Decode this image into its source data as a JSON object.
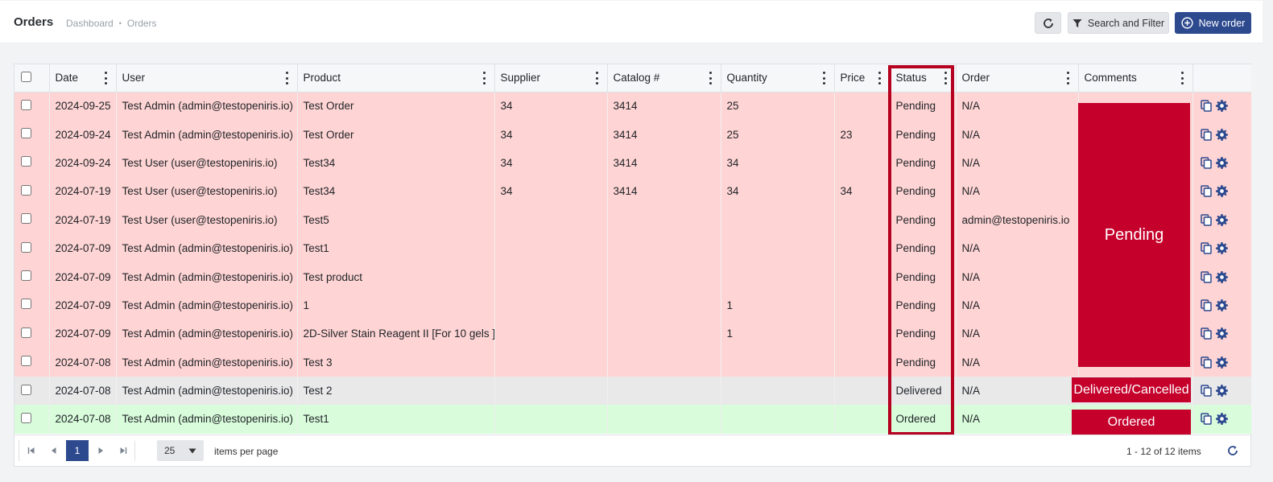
{
  "header": {
    "title": "Orders",
    "breadcrumb": [
      "Dashboard",
      "Orders"
    ],
    "breadcrumb_sep": "•",
    "filter_label": "Search and Filter",
    "new_label": "New order"
  },
  "columns": [
    "",
    "Date",
    "User",
    "Product",
    "Supplier",
    "Catalog #",
    "Quantity",
    "Price",
    "Status",
    "Order",
    "Comments",
    ""
  ],
  "rows": [
    {
      "date": "2024-09-25",
      "user": "Test Admin (admin@testopeniris.io)",
      "product": "Test Order",
      "supplier": "34",
      "catalog": "3414",
      "quantity": "25",
      "price": "",
      "status": "Pending",
      "order": "N/A"
    },
    {
      "date": "2024-09-24",
      "user": "Test Admin (admin@testopeniris.io)",
      "product": "Test Order",
      "supplier": "34",
      "catalog": "3414",
      "quantity": "25",
      "price": "23",
      "status": "Pending",
      "order": "N/A"
    },
    {
      "date": "2024-09-24",
      "user": "Test User (user@testopeniris.io)",
      "product": "Test34",
      "supplier": "34",
      "catalog": "3414",
      "quantity": "34",
      "price": "",
      "status": "Pending",
      "order": "N/A"
    },
    {
      "date": "2024-07-19",
      "user": "Test User (user@testopeniris.io)",
      "product": "Test34",
      "supplier": "34",
      "catalog": "3414",
      "quantity": "34",
      "price": "34",
      "status": "Pending",
      "order": "N/A"
    },
    {
      "date": "2024-07-19",
      "user": "Test User (user@testopeniris.io)",
      "product": "Test5",
      "supplier": "",
      "catalog": "",
      "quantity": "",
      "price": "",
      "status": "Pending",
      "order": "admin@testopeniris.io"
    },
    {
      "date": "2024-07-09",
      "user": "Test Admin (admin@testopeniris.io)",
      "product": "Test1",
      "supplier": "",
      "catalog": "",
      "quantity": "",
      "price": "",
      "status": "Pending",
      "order": "N/A"
    },
    {
      "date": "2024-07-09",
      "user": "Test Admin (admin@testopeniris.io)",
      "product": "Test product",
      "supplier": "",
      "catalog": "",
      "quantity": "",
      "price": "",
      "status": "Pending",
      "order": "N/A"
    },
    {
      "date": "2024-07-09",
      "user": "Test Admin (admin@testopeniris.io)",
      "product": "1",
      "supplier": "",
      "catalog": "",
      "quantity": "1",
      "price": "",
      "status": "Pending",
      "order": "N/A"
    },
    {
      "date": "2024-07-09",
      "user": "Test Admin (admin@testopeniris.io)",
      "product": "2D-Silver Stain Reagent II [For 10 gels ]",
      "supplier": "",
      "catalog": "",
      "quantity": "1",
      "price": "",
      "status": "Pending",
      "order": "N/A"
    },
    {
      "date": "2024-07-08",
      "user": "Test Admin (admin@testopeniris.io)",
      "product": "Test 3",
      "supplier": "",
      "catalog": "",
      "quantity": "",
      "price": "",
      "status": "Pending",
      "order": "N/A"
    },
    {
      "date": "2024-07-08",
      "user": "Test Admin (admin@testopeniris.io)",
      "product": "Test 2",
      "supplier": "",
      "catalog": "",
      "quantity": "",
      "price": "",
      "status": "Delivered",
      "order": "N/A"
    },
    {
      "date": "2024-07-08",
      "user": "Test Admin (admin@testopeniris.io)",
      "product": "Test1",
      "supplier": "",
      "catalog": "",
      "quantity": "",
      "price": "",
      "status": "Ordered",
      "order": "N/A"
    }
  ],
  "comments": {
    "pending": "Pending",
    "delivered": "Delivered/Cancelled",
    "ordered": "Ordered"
  },
  "pager": {
    "current_page": "1",
    "page_size": "25",
    "per_page_label": "items per page",
    "info": "1 - 12 of 12 items"
  },
  "colors": {
    "accent": "#2d4a8f",
    "pending_row": "#ffd4d4",
    "delivered_row": "#e9e9ea",
    "ordered_row": "#d9fcdb",
    "comment_highlight": "#c4002b"
  },
  "icons": {
    "refresh": "refresh-icon",
    "filter": "filter-icon",
    "new": "plus-circle-icon",
    "copy": "copy-icon",
    "settings": "gear-icon"
  }
}
